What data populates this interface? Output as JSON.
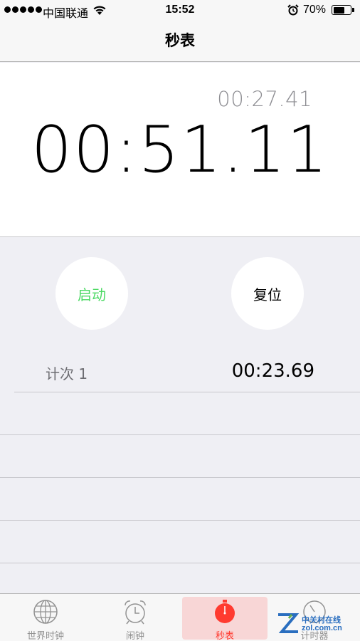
{
  "status_bar": {
    "carrier": "中国联通",
    "time": "15:52",
    "battery_percent": "70%",
    "battery_level": 0.7
  },
  "nav": {
    "title": "秒表"
  },
  "timer": {
    "lap_time": "00:27.41",
    "main_time": "00:51.11"
  },
  "controls": {
    "start_label": "启动",
    "reset_label": "复位",
    "start_color": "#4cd964"
  },
  "laps": [
    {
      "label": "计次 1",
      "time": "00:23.69"
    }
  ],
  "tabs": [
    {
      "label": "世界时钟",
      "icon": "globe-icon"
    },
    {
      "label": "闹钟",
      "icon": "alarm-clock-icon"
    },
    {
      "label": "秒表",
      "icon": "stopwatch-icon",
      "active": true
    },
    {
      "label": "计时器",
      "icon": "timer-icon"
    }
  ],
  "watermark": {
    "line1": "中关村在线",
    "line2": "zol.com.cn"
  },
  "colors": {
    "accent": "#ff3b30",
    "tab_inactive": "#929292"
  }
}
